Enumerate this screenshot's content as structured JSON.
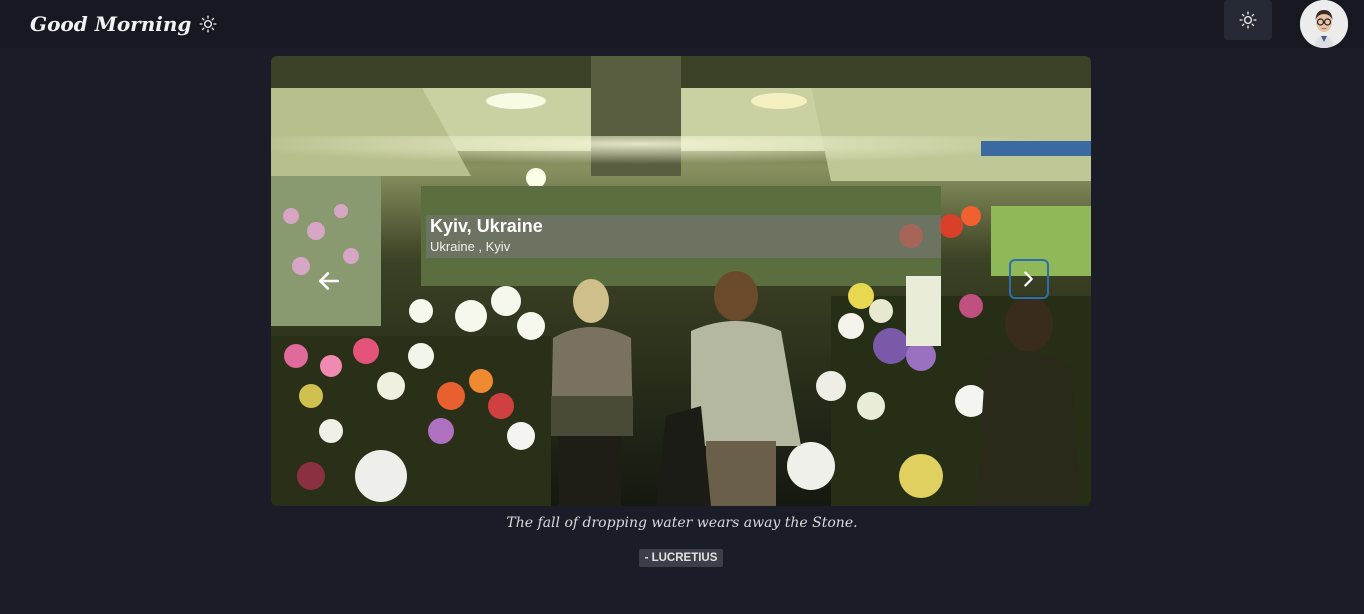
{
  "header": {
    "greeting": "Good Morning",
    "greeting_icon": "sun-icon",
    "theme_toggle_icon": "sun-icon",
    "avatar": "user-avatar"
  },
  "carousel": {
    "title": "Kyiv, Ukraine",
    "subtitle": "Ukraine , Kyiv",
    "prev_icon": "arrow-left-icon",
    "next_icon": "chevron-right-icon",
    "next_focus_color": "#2d6fa8"
  },
  "quote": {
    "text": "The fall of dropping water wears away the Stone.",
    "author": "- LUCRETIUS"
  },
  "colors": {
    "background": "#1a1c27",
    "header": "#161922",
    "button": "#262a34"
  }
}
